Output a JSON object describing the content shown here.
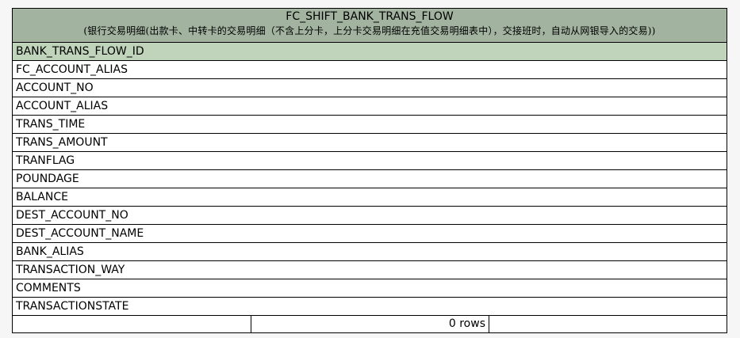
{
  "table": {
    "name": "FC_SHIFT_BANK_TRANS_FLOW",
    "comment": "(银行交易明细(出款卡、中转卡的交易明细（不含上分卡，上分卡交易明细在充值交易明细表中），交接班时，自动从网银导入的交易))",
    "primary_key": "BANK_TRANS_FLOW_ID",
    "columns": [
      "FC_ACCOUNT_ALIAS",
      "ACCOUNT_NO",
      "ACCOUNT_ALIAS",
      "TRANS_TIME",
      "TRANS_AMOUNT",
      "TRANFLAG",
      "POUNDAGE",
      "BALANCE",
      "DEST_ACCOUNT_NO",
      "DEST_ACCOUNT_NAME",
      "BANK_ALIAS",
      "TRANSACTION_WAY",
      "COMMENTS",
      "TRANSACTIONSTATE"
    ],
    "footer": {
      "left": "",
      "rows_text": "0 rows",
      "right": ""
    }
  },
  "colors": {
    "header_bg": "#a2b3a0",
    "pk_bg": "#bfd4bb",
    "body_bg": "#ffffff",
    "page_bg": "#f6f6f6"
  }
}
